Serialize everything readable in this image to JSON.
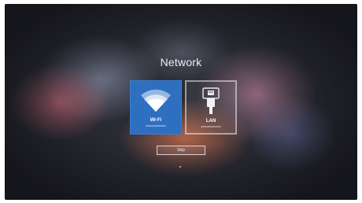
{
  "page": {
    "title": "Network"
  },
  "options": [
    {
      "id": "wifi",
      "label": "Wi-Fi",
      "icon": "wifi-icon",
      "selected": true
    },
    {
      "id": "lan",
      "label": "LAN",
      "icon": "lan-cable-icon",
      "selected": false
    }
  ],
  "actions": {
    "skip_label": "Skip"
  },
  "colors": {
    "selected_tile": "#2f6fc0",
    "text": "#ffffff"
  }
}
